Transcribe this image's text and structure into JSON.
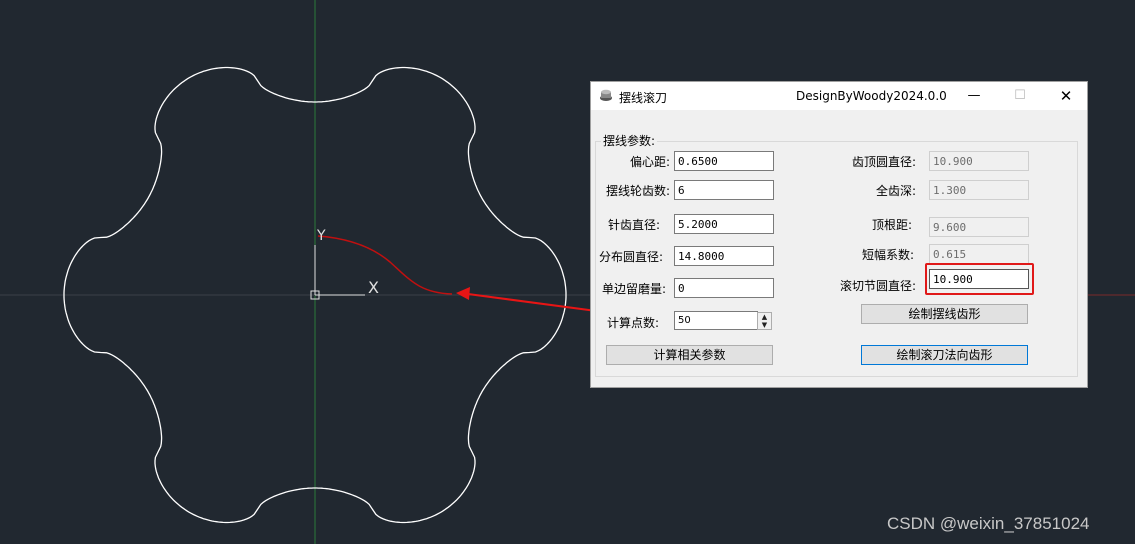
{
  "canvas": {
    "ucs_y_label": "Y",
    "ucs_x_label": "X",
    "colors": {
      "background": "#212830",
      "profile": "#ffffff",
      "curve": "#c01010",
      "annotation": "#e81515",
      "axis_green": "#2c7a3a",
      "axis_red": "#7a2a2a"
    }
  },
  "dialog": {
    "title": "摆线滚刀",
    "brand": "DesignByWoody2024.0.0",
    "minimize_icon": "minimize-icon",
    "maximize_icon": "maximize-icon",
    "close_icon": "close-icon",
    "group_label": "摆线参数:",
    "left": {
      "eccentricity_label": "偏心距:",
      "eccentricity_value": "0.6500",
      "teeth_label": "摆线轮齿数:",
      "teeth_value": "6",
      "pin_diameter_label": "针齿直径:",
      "pin_diameter_value": "5.2000",
      "pitch_diameter_label": "分布圆直径:",
      "pitch_diameter_value": "14.8000",
      "grind_allowance_label": "单边留磨量:",
      "grind_allowance_value": "0",
      "points_label": "计算点数:",
      "points_value": "50",
      "calc_button": "计算相关参数"
    },
    "right": {
      "tip_diameter_label": "齿顶圆直径:",
      "tip_diameter_value": "10.900",
      "full_depth_label": "全齿深:",
      "full_depth_value": "1.300",
      "root_distance_label": "顶根距:",
      "root_distance_value": "9.600",
      "short_coef_label": "短幅系数:",
      "short_coef_value": "0.615",
      "hob_pitch_label": "滚切节圆直径:",
      "hob_pitch_value": "10.900",
      "draw_cycloid_button": "绘制摆线齿形",
      "draw_hob_button": "绘制滚刀法向齿形"
    }
  },
  "watermark": "CSDN @weixin_37851024"
}
